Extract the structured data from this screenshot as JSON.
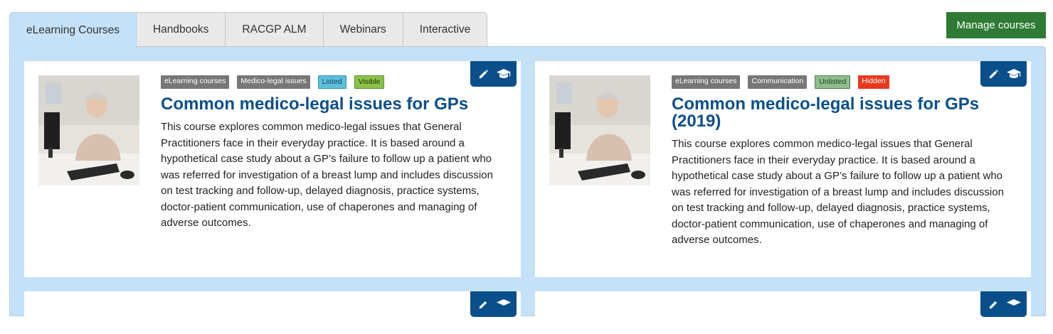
{
  "tabs": [
    "eLearning Courses",
    "Handbooks",
    "RACGP ALM",
    "Webinars",
    "Interactive"
  ],
  "manage_button": "Manage courses",
  "colors": {
    "accent": "#0b4f8a",
    "panel": "#c5e1f7",
    "manage": "#2f7a34"
  },
  "cards": [
    {
      "badges": [
        "eLearning courses",
        "Medico-legal issues",
        "Listed",
        "Visible"
      ],
      "title": "Common medico-legal issues for GPs",
      "description": "This course explores common medico-legal issues that General Practitioners face in their everyday practice. It is based around a hypothetical case study about a GP’s failure to follow up a patient who was referred for investigation of a breast lump and includes discussion on test tracking and follow-up, delayed diagnosis, practice systems, doctor-patient communication, use of chaperones and managing of adverse outcomes.",
      "actions": [
        "pencil-icon",
        "graduation-cap-icon"
      ]
    },
    {
      "badges": [
        "eLearning courses",
        "Communication",
        "Unlisted",
        "Hidden"
      ],
      "title": "Common medico-legal issues for GPs (2019)",
      "description": "This course explores common medico-legal issues that General Practitioners face in their everyday practice. It is based around a hypothetical case study about a GP’s failure to follow up a patient who was referred for investigation of a breast lump and includes discussion on test tracking and follow-up, delayed diagnosis, practice systems, doctor-patient communication, use of chaperones and managing of adverse outcomes.",
      "actions": [
        "pencil-icon",
        "graduation-cap-icon"
      ]
    }
  ]
}
